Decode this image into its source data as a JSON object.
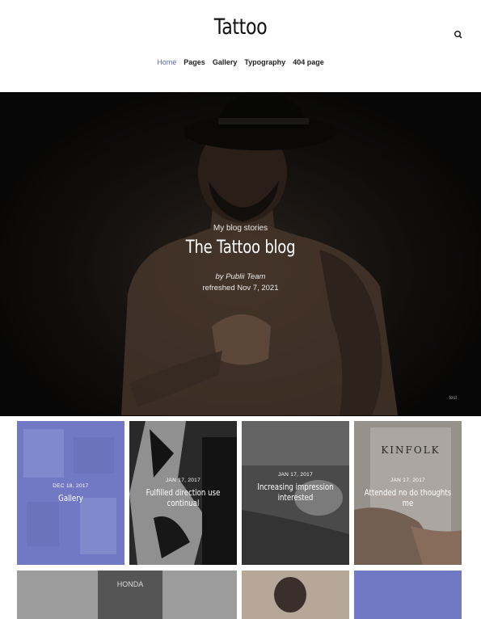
{
  "site": {
    "title": "Tattoo"
  },
  "nav": {
    "items": [
      "Home",
      "Pages",
      "Gallery",
      "Typography",
      "404 page"
    ]
  },
  "hero": {
    "subtitle": "My blog stories",
    "title": "The Tattoo blog",
    "author": "by Publii Team",
    "date": "refreshed Nov 7, 2021",
    "credit": "test"
  },
  "posts": [
    {
      "date": "DEC 18, 2017",
      "title": "Gallery",
      "color": "#7279c4"
    },
    {
      "date": "JAN 17, 2017",
      "title": "Fulfilled direction use continual"
    },
    {
      "date": "JAN 17, 2017",
      "title": "Increasing impression interested"
    },
    {
      "date": "JAN 17, 2017",
      "title": "Attended no do thoughts me"
    }
  ],
  "colors": {
    "accent": "#5b6bb3"
  }
}
